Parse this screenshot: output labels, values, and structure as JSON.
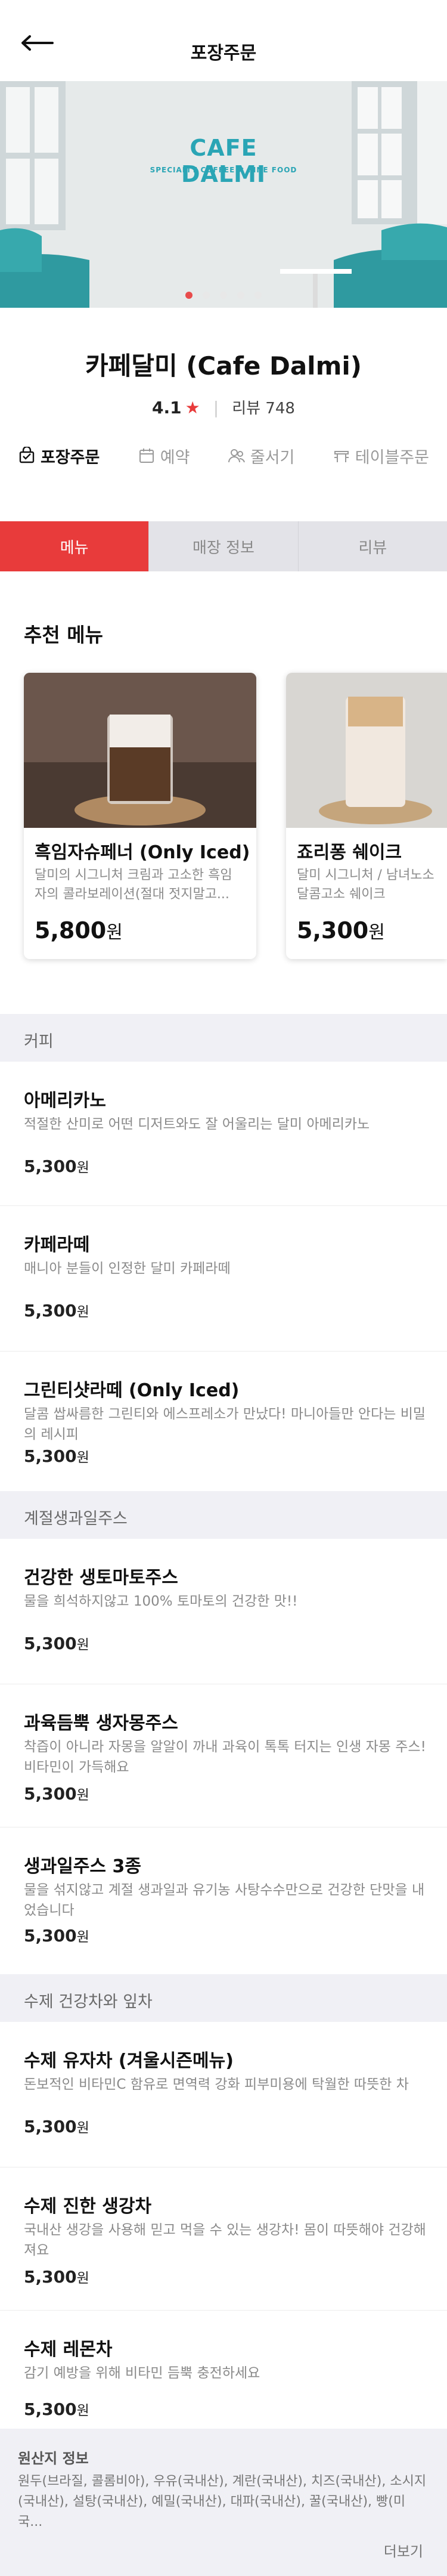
{
  "header": {
    "title": "포장주문"
  },
  "hero": {
    "logo_title": "CAFE DALMI",
    "logo_sub": "SPECIALTY COFFEE ✖ FINE FOOD",
    "slide_count": 5,
    "active_slide": 1
  },
  "store": {
    "name": "카페달미 (Cafe Dalmi)",
    "rating": "4.1",
    "review_label": "리뷰 748"
  },
  "order_types": [
    {
      "label": "포장주문",
      "icon": "bag-icon",
      "active": true
    },
    {
      "label": "예약",
      "icon": "calendar-icon",
      "active": false
    },
    {
      "label": "줄서기",
      "icon": "people-icon",
      "active": false
    },
    {
      "label": "테이블주문",
      "icon": "table-icon",
      "active": false
    }
  ],
  "tabs": [
    "메뉴",
    "매장 정보",
    "리뷰"
  ],
  "recommended": {
    "title": "추천 메뉴",
    "items": [
      {
        "name": "흑임자슈페너 (Only Iced)",
        "desc": "달미의 시그니처 크림과 고소한 흑임자의 콜라보레이션(절대 젓지말고...",
        "price": "5,800",
        "unit": "원"
      },
      {
        "name": "죠리퐁 쉐이크",
        "desc": "달미 시그니처 / 남녀노소 달콤고소 쉐이크",
        "price": "5,300",
        "unit": "원"
      }
    ]
  },
  "sections": [
    {
      "title": "커피",
      "items": [
        {
          "name": "아메리카노",
          "desc": "적절한 산미로 어떤 디저트와도 잘 어울리는 달미 아메리카노",
          "price": "5,300",
          "unit": "원"
        },
        {
          "name": "카페라떼",
          "desc": "매니아 분들이 인정한 달미 카페라떼",
          "price": "5,300",
          "unit": "원"
        },
        {
          "name": "그린티샷라떼 (Only Iced)",
          "desc": "달콤 쌉싸름한 그린티와 에스프레소가 만났다! 마니아들만 안다는 비밀의 레시피",
          "price": "5,300",
          "unit": "원"
        }
      ]
    },
    {
      "title": "계절생과일주스",
      "items": [
        {
          "name": "건강한 생토마토주스",
          "desc": "물을 희석하지않고 100% 토마토의 건강한 맛!!",
          "price": "5,300",
          "unit": "원"
        },
        {
          "name": "과육듬뿍 생자몽주스",
          "desc": "착즙이 아니라 자몽을 알알이 까내 과육이 톡톡 터지는 인생 자몽 주스! 비타민이 가득해요",
          "price": "5,300",
          "unit": "원"
        },
        {
          "name": "생과일주스 3종",
          "desc": "물을 섞지않고 계절 생과일과 유기농 사탕수수만으로 건강한 단맛을 내었습니다",
          "price": "5,300",
          "unit": "원"
        }
      ]
    },
    {
      "title": "수제 건강차와 잎차",
      "items": [
        {
          "name": "수제 유자차 (겨울시즌메뉴)",
          "desc": "돈보적인 비타민C 함유로 면역력 강화 피부미용에 탁월한 따뜻한 차",
          "price": "5,300",
          "unit": "원"
        },
        {
          "name": "수제 진한 생강차",
          "desc": "국내산 생강을 사용해 믿고 먹을 수 있는 생강차! 몸이 따뜻해야 건강해져요",
          "price": "5,300",
          "unit": "원"
        },
        {
          "name": "수제 레몬차",
          "desc": "감기 예방을 위해 비타민 듬뿍 충전하세요",
          "price": "5,300",
          "unit": "원"
        }
      ]
    }
  ],
  "footer": {
    "title": "원산지 정보",
    "text": "원두(브라질, 콜롬비아), 우유(국내산), 계란(국내산), 치즈(국내산), 소시지(국내산), 설탕(국내산), 예밀(국내산), 대파(국내산), 꿀(국내산), 빵(미국...",
    "more": "더보기"
  },
  "colors": {
    "accent": "#e83b3b",
    "tab_inactive": "#e3e3e8",
    "section_bg": "#f0f0f5",
    "brand_teal": "#2aa5b5"
  }
}
